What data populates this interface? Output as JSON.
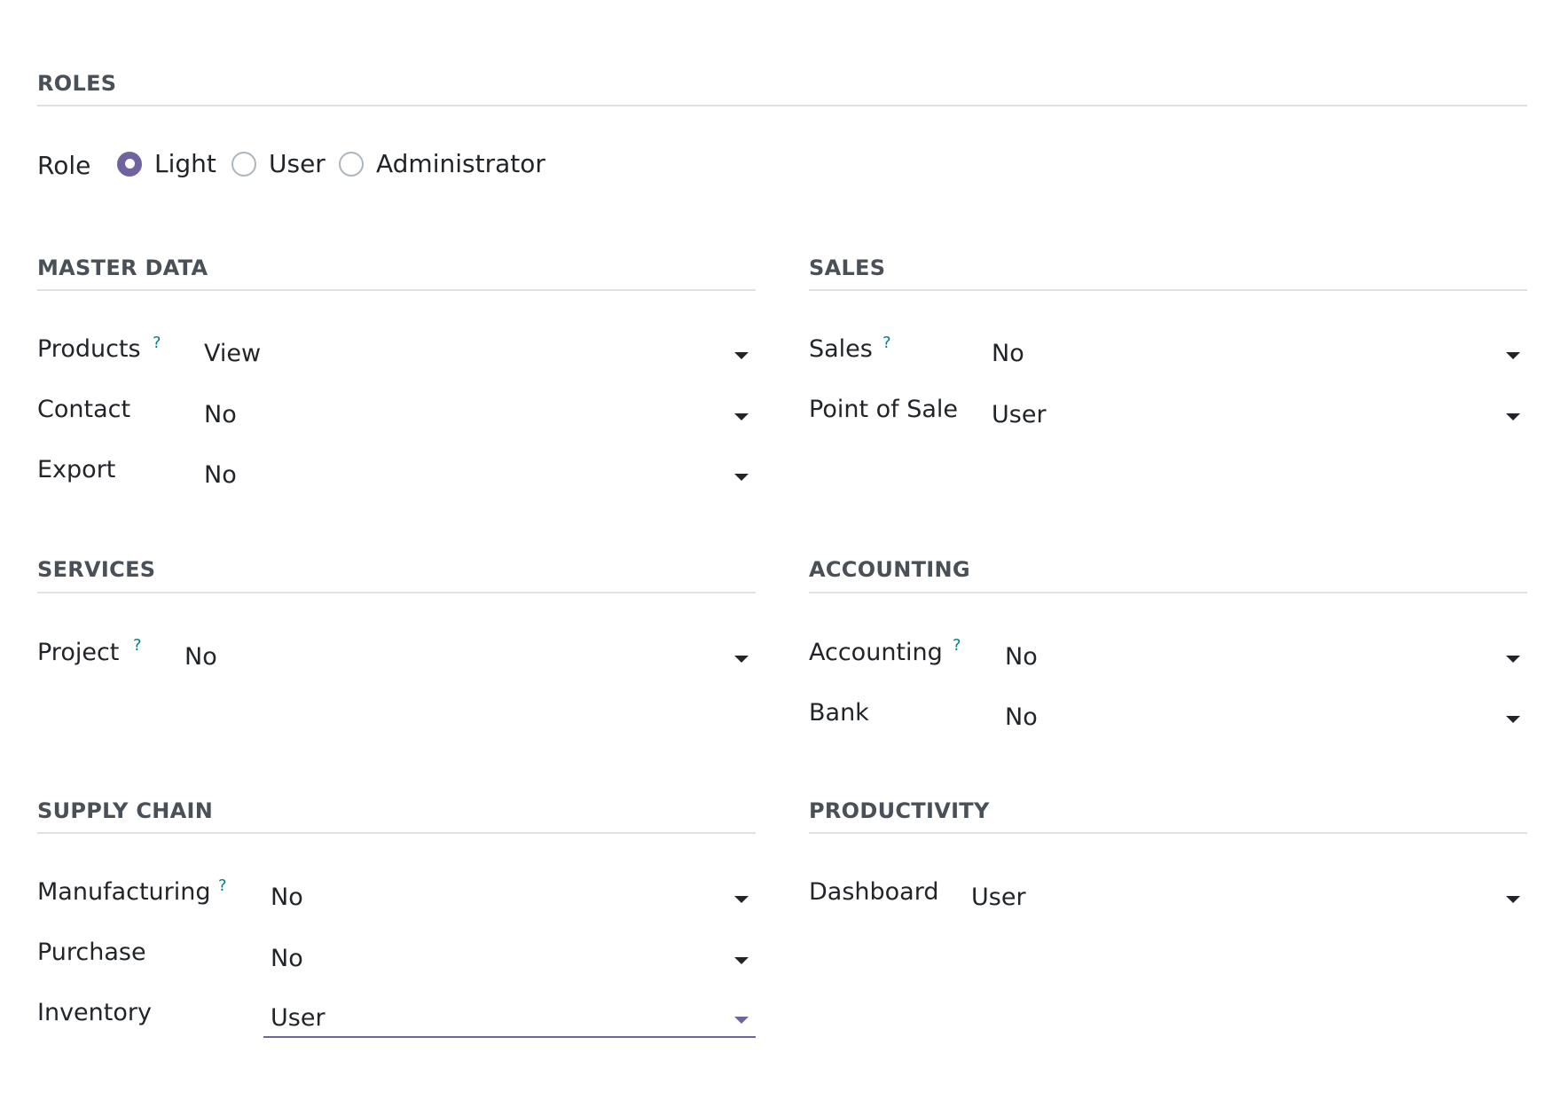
{
  "roles": {
    "title": "ROLES",
    "role_label": "Role",
    "options": [
      "Light",
      "User",
      "Administrator"
    ],
    "selected": "Light"
  },
  "master_data": {
    "title": "MASTER DATA",
    "fields": [
      {
        "label": "Products",
        "help": "?",
        "value": "View"
      },
      {
        "label": "Contact",
        "value": "No"
      },
      {
        "label": "Export",
        "value": "No"
      }
    ]
  },
  "sales": {
    "title": "SALES",
    "fields": [
      {
        "label": "Sales",
        "help": "?",
        "value": "No"
      },
      {
        "label": "Point of Sale",
        "value": "User"
      }
    ]
  },
  "services": {
    "title": "SERVICES",
    "fields": [
      {
        "label": "Project",
        "help": "?",
        "value": "No"
      }
    ]
  },
  "accounting": {
    "title": "ACCOUNTING",
    "fields": [
      {
        "label": "Accounting",
        "help": "?",
        "value": "No"
      },
      {
        "label": "Bank",
        "value": "No"
      }
    ]
  },
  "supply_chain": {
    "title": "SUPPLY CHAIN",
    "fields": [
      {
        "label": "Manufacturing",
        "help": "?",
        "value": "No"
      },
      {
        "label": "Purchase",
        "value": "No"
      },
      {
        "label": "Inventory",
        "value": "User"
      }
    ]
  },
  "productivity": {
    "title": "PRODUCTIVITY",
    "fields": [
      {
        "label": "Dashboard",
        "value": "User"
      }
    ]
  },
  "colors": {
    "accent": "#71639e",
    "help": "#017e84",
    "section_title": "#495057",
    "divider": "#dee2e6"
  }
}
